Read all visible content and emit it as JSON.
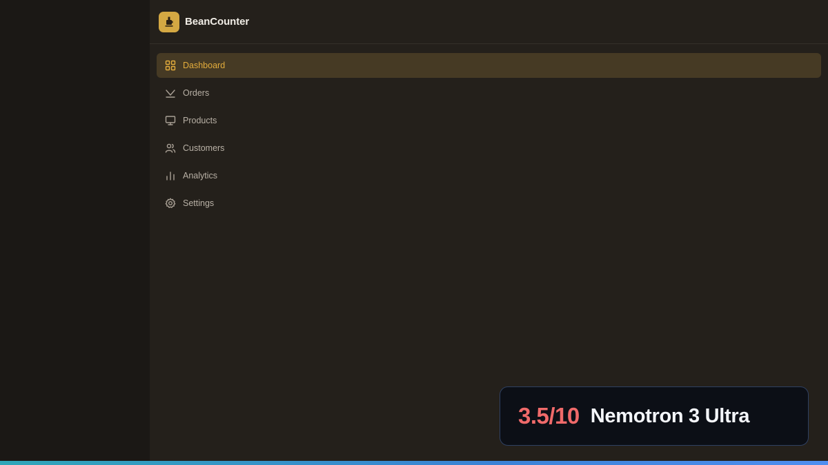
{
  "app": {
    "name": "BeanCounter",
    "logo_icon": "coffee-press-icon",
    "accent_color": "#e4ad3c"
  },
  "sidebar": {
    "items": [
      {
        "label": "Dashboard",
        "icon": "grid-icon",
        "active": true
      },
      {
        "label": "Orders",
        "icon": "download-icon",
        "active": false
      },
      {
        "label": "Products",
        "icon": "monitor-icon",
        "active": false
      },
      {
        "label": "Customers",
        "icon": "users-icon",
        "active": false
      },
      {
        "label": "Analytics",
        "icon": "bar-chart-icon",
        "active": false
      },
      {
        "label": "Settings",
        "icon": "gear-icon",
        "active": false
      }
    ]
  },
  "score_card": {
    "score": "3.5/10",
    "model": "Nemotron 3 Ultra",
    "score_color": "#f06a6a"
  }
}
